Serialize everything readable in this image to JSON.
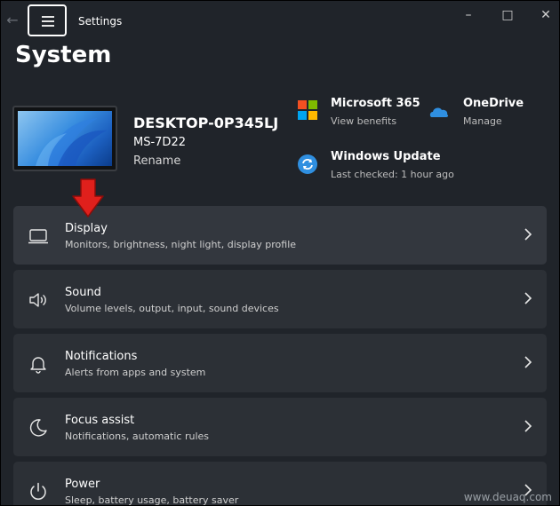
{
  "window": {
    "app_title": "Settings",
    "page_title": "System"
  },
  "device": {
    "name": "DESKTOP-0P345LJ",
    "model": "MS-7D22",
    "rename_label": "Rename"
  },
  "quick_links": [
    {
      "title": "Microsoft 365",
      "subtitle": "View benefits",
      "icon": "microsoft-365-icon"
    },
    {
      "title": "OneDrive",
      "subtitle": "Manage",
      "icon": "onedrive-icon"
    },
    {
      "title": "Windows Update",
      "subtitle": "Last checked: 1 hour ago",
      "icon": "windows-update-icon"
    }
  ],
  "settings": [
    {
      "title": "Display",
      "subtitle": "Monitors, brightness, night light, display profile",
      "icon": "monitor-icon"
    },
    {
      "title": "Sound",
      "subtitle": "Volume levels, output, input, sound devices",
      "icon": "speaker-icon"
    },
    {
      "title": "Notifications",
      "subtitle": "Alerts from apps and system",
      "icon": "bell-icon"
    },
    {
      "title": "Focus assist",
      "subtitle": "Notifications, automatic rules",
      "icon": "moon-icon"
    },
    {
      "title": "Power",
      "subtitle": "Sleep, battery usage, battery saver",
      "icon": "power-icon"
    }
  ],
  "annotation": {
    "icon": "red-down-arrow-icon",
    "color": "#e0201c"
  },
  "watermark": "www.deuaq.com",
  "colors": {
    "background": "#20242a",
    "card": "#2c3036",
    "accent_blue": "#2f8fe0"
  }
}
